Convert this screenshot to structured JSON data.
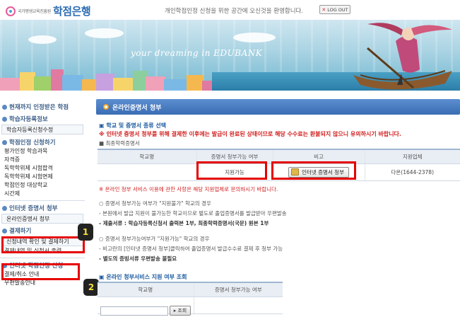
{
  "header": {
    "logo_org": "국가평생교육진흥원",
    "logo_name": "학점은행",
    "welcome": "개인학점인정 신청을 위한 공간에 오신것을 환영합니다.",
    "logout_label": "LOG OUT"
  },
  "banner": {
    "slogan": "your dreaming  in  EDUBANK"
  },
  "sidebar": {
    "sections": [
      {
        "heading": "현재까지 인정받은 학점"
      },
      {
        "heading": "학습자등록정보"
      },
      {
        "item_box": "학습자등록신청수정"
      },
      {
        "heading": "학점인정 신청하기"
      },
      {
        "items": [
          "평가인정 학습과목",
          "자격증",
          "독학학위제 시험합격",
          "독학학위제 시험면제",
          "학점인정 대상학교",
          "시간제"
        ]
      },
      {
        "heading": "인터넷 증명서 청부"
      },
      {
        "item_box": "온라인증명서 청부"
      },
      {
        "heading": "결제하기"
      },
      {
        "item_box": "신청내역 확인 및 결제하기"
      },
      {
        "item_plain": "결제내역 및 신청서 출력"
      },
      {
        "heading": "인터넷 학점인정 신청"
      },
      {
        "items": [
          "결제/취소 안내",
          "우편발송안내"
        ]
      }
    ],
    "callouts": [
      "1",
      "2"
    ]
  },
  "main": {
    "page_title": "온라인증명서 청부",
    "section1_title": "▣ 학교 및 증명서 종류 선택",
    "warning": "※ 인터넷 증명서 청부를 위해 결제한 이후에는 발급이 완료된 상태이므로 해당 수수료는 환불되지 않으니 유의하시기 바랍니다.",
    "cert_label": "■ 최종학력증명서",
    "table1": {
      "headers": [
        "학교명",
        "증명서 청부가능 여부",
        "비고",
        "지원업체"
      ],
      "row": [
        "",
        "지원가능",
        "인터넷 증명서 청부",
        "다온(1644-2378)"
      ]
    },
    "inquiry_note": "※ 온라인 청부 서비스 이용에 관한 사항은 해당 지원업체로 문의하시기 바랍니다.",
    "notes": [
      "○ 증명서 청부가능 여부가 \"지원불가\" 학교의 경우",
      "- 본원에서 발급 지원이 불가능한 학교이므로 별도로 졸업증명서를 발급받아 우편발송",
      "- 제출서류 : 학습자등록신청서 출력본 1부, 최종학력증명서(국문) 원본 1부",
      "○ 증명서 청부가능여부가 \"지원가능\" 학교의 경우",
      "- 비고란의 [인터넷 증명서 청부]클릭하여 졸업증명서 발급수수료 결제 후 청부 가능",
      "- 별도의 증빙서류 우편발송 불필요"
    ],
    "section2_title": "▣ 온라인 청부서비스 지원 여부 조회",
    "table2": {
      "headers": [
        "학교명",
        "증명서 청부가능 여부"
      ]
    },
    "search_label": "조회"
  },
  "colors": {
    "accent_blue": "#3a6cb4",
    "highlight_red": "#e60000",
    "warning_red": "#d21f1f"
  }
}
